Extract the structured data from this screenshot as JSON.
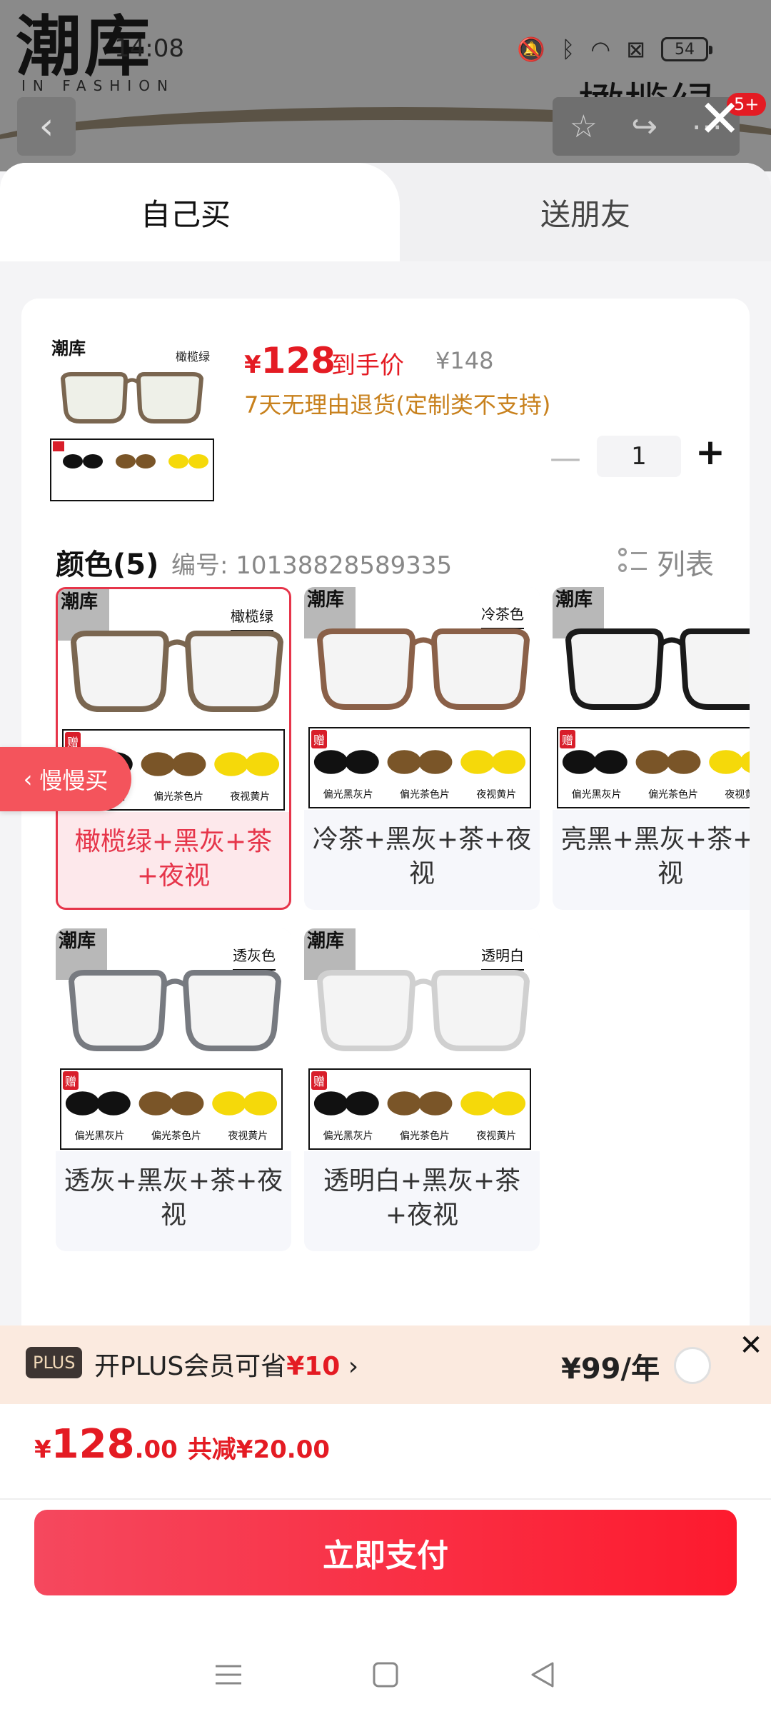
{
  "background": {
    "logo": "潮库",
    "logo_sub": "IN FASHION",
    "status_time": "14:08",
    "battery": "54",
    "title": "橄榄绿",
    "badge": "5+"
  },
  "tabs": {
    "self": "自己买",
    "friend": "送朋友"
  },
  "product": {
    "thumb_logo": "潮库",
    "thumb_color": "橄榄绿",
    "price_currency": "¥",
    "price": "128",
    "price_tag": "到手价",
    "original_price": "¥148",
    "return_policy": "7天无理由退货(定制类不支持)",
    "quantity": "1"
  },
  "colors": {
    "title": "颜色(5)",
    "code": "编号: 10138828589335",
    "list_view_label": "列表",
    "lens_labels": [
      "偏光黑灰片",
      "偏光茶色片",
      "夜视黄片"
    ],
    "gift_label": "赠",
    "options": [
      {
        "tag": "橄榄绿",
        "label": "橄榄绿+黑灰+茶+夜视",
        "frame_color": "#7a6650",
        "selected": true
      },
      {
        "tag": "冷茶色",
        "label": "冷茶+黑灰+茶+夜视",
        "frame_color": "#8a6048",
        "selected": false
      },
      {
        "tag": "",
        "label": "亮黑+黑灰+茶+夜视",
        "frame_color": "#1a1a1a",
        "selected": false
      },
      {
        "tag": "透灰色",
        "label": "透灰+黑灰+茶+夜视",
        "frame_color": "#777a80",
        "selected": false
      },
      {
        "tag": "透明白",
        "label": "透明白+黑灰+茶+夜视",
        "frame_color": "#d0d0d0",
        "selected": false
      }
    ]
  },
  "slow_buy": "慢慢买",
  "plus": {
    "badge": "PLUS",
    "text_prefix": "开PLUS会员可省",
    "save_amount": "¥10",
    "price": "¥99/年"
  },
  "total": {
    "currency": "¥",
    "integer": "128",
    "decimal": ".00",
    "discount": "共减¥20.00"
  },
  "pay_button": "立即支付",
  "accent_color": "#e41b23"
}
